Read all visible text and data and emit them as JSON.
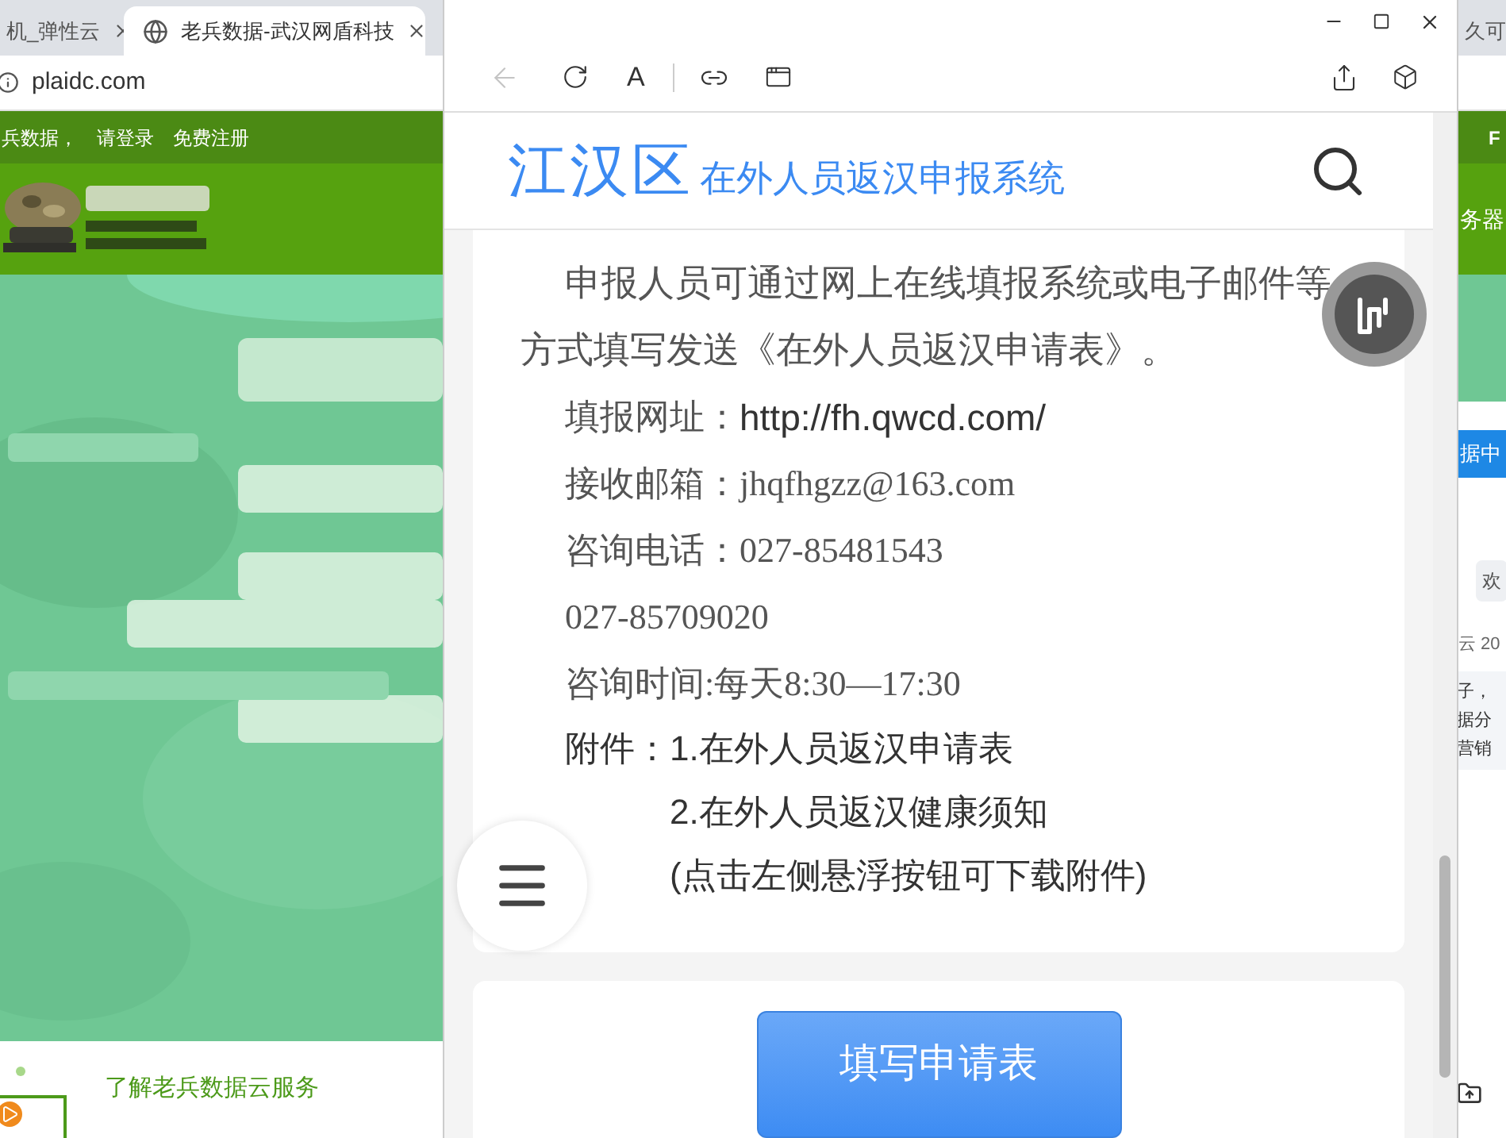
{
  "background_browser": {
    "tabs": [
      {
        "title": "机_弹性云",
        "selected": false
      },
      {
        "title": "老兵数据-武汉网盾科技",
        "selected": true
      },
      {
        "title": "久可",
        "selected": false
      }
    ],
    "address": "plaidc.com",
    "site": {
      "top_links": [
        "兵数据，",
        "请登录",
        "免费注册"
      ],
      "promo_link": "了解老兵数据云服务"
    },
    "right_edge": {
      "nav_text": "F",
      "header_text": "务器",
      "blue_band_text": "据中",
      "chip": "欢",
      "date_text": "云 20",
      "lines": [
        "子，",
        "据分",
        "营销"
      ]
    }
  },
  "popup_window": {
    "toolbar": {
      "back_disabled": true,
      "font_button": "A"
    },
    "page": {
      "header": {
        "district": "江汉区",
        "system": "在外人员返汉申报系统"
      },
      "paragraph": "申报人员可通过网上在线填报系统或电子邮件等方式填写发送《在外人员返汉申请表》。",
      "lines": [
        {
          "kind": "link",
          "label": "填报网址：",
          "value": "http://fh.qwcd.com/"
        },
        {
          "kind": "plain",
          "text": "接收邮箱：jhqfhgzz@163.com"
        },
        {
          "kind": "plain",
          "text": "咨询电话：027-85481543"
        },
        {
          "kind": "plain",
          "text": "027-85709020"
        },
        {
          "kind": "plain",
          "text": "咨询时间:每天8:30—17:30"
        }
      ],
      "attachments": {
        "label": "附件：",
        "items": [
          "1.在外人员返汉申请表",
          "2.在外人员返汉健康须知"
        ],
        "note": "(点击左侧悬浮按钮可下载附件)"
      },
      "submit_button": "填写申请表"
    }
  }
}
